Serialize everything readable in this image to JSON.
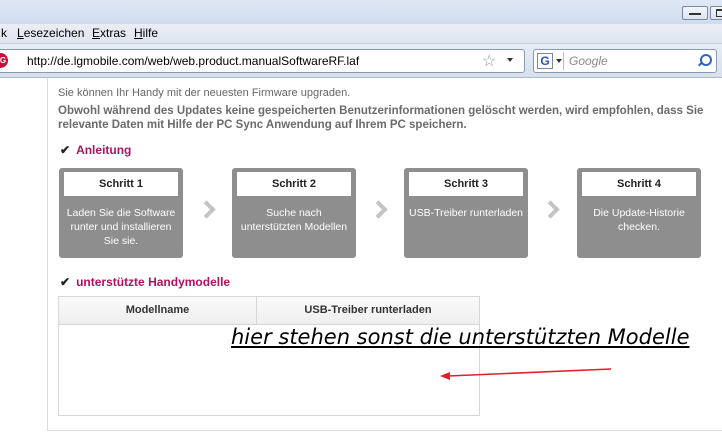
{
  "menubar": {
    "items": [
      "k",
      "Lesezeichen",
      "Extras",
      "Hilfe"
    ],
    "underlined": [
      "",
      "L",
      "E",
      "H"
    ]
  },
  "navbar": {
    "url": "http://de.lgmobile.com/web/web.product.manualSoftwareRF.laf",
    "site_icon_text": "LG",
    "search_placeholder": "Google",
    "search_engine_icon": "G"
  },
  "page": {
    "intro": "Sie können Ihr Handy mit der neuesten Firmware upgraden.",
    "warning": "Obwohl während des Updates keine gespeicherten Benutzerinformationen gelöscht werden, wird empfohlen, dass Sie relevante Daten mit Hilfe der PC Sync Anwendung auf Ihrem PC speichern.",
    "section_guide": "Anleitung",
    "steps": [
      {
        "title": "Schritt 1",
        "desc": "Laden Sie die Software runter und installieren Sie sie."
      },
      {
        "title": "Schritt 2",
        "desc": "Suche nach unterstützten Modellen"
      },
      {
        "title": "Schritt 3",
        "desc": "USB-Treiber runterladen"
      },
      {
        "title": "Schritt 4",
        "desc": "Die Update-Historie checken."
      }
    ],
    "section_models": "unterstützte Handymodelle",
    "table_headers": [
      "Modellname",
      "USB-Treiber runterladen"
    ],
    "annotation": "hier stehen sonst die unterstützten Modelle",
    "colors": {
      "accent": "#b0125f",
      "step_bg": "#8e8e8e",
      "annotation_arrow": "#e0202a"
    }
  }
}
